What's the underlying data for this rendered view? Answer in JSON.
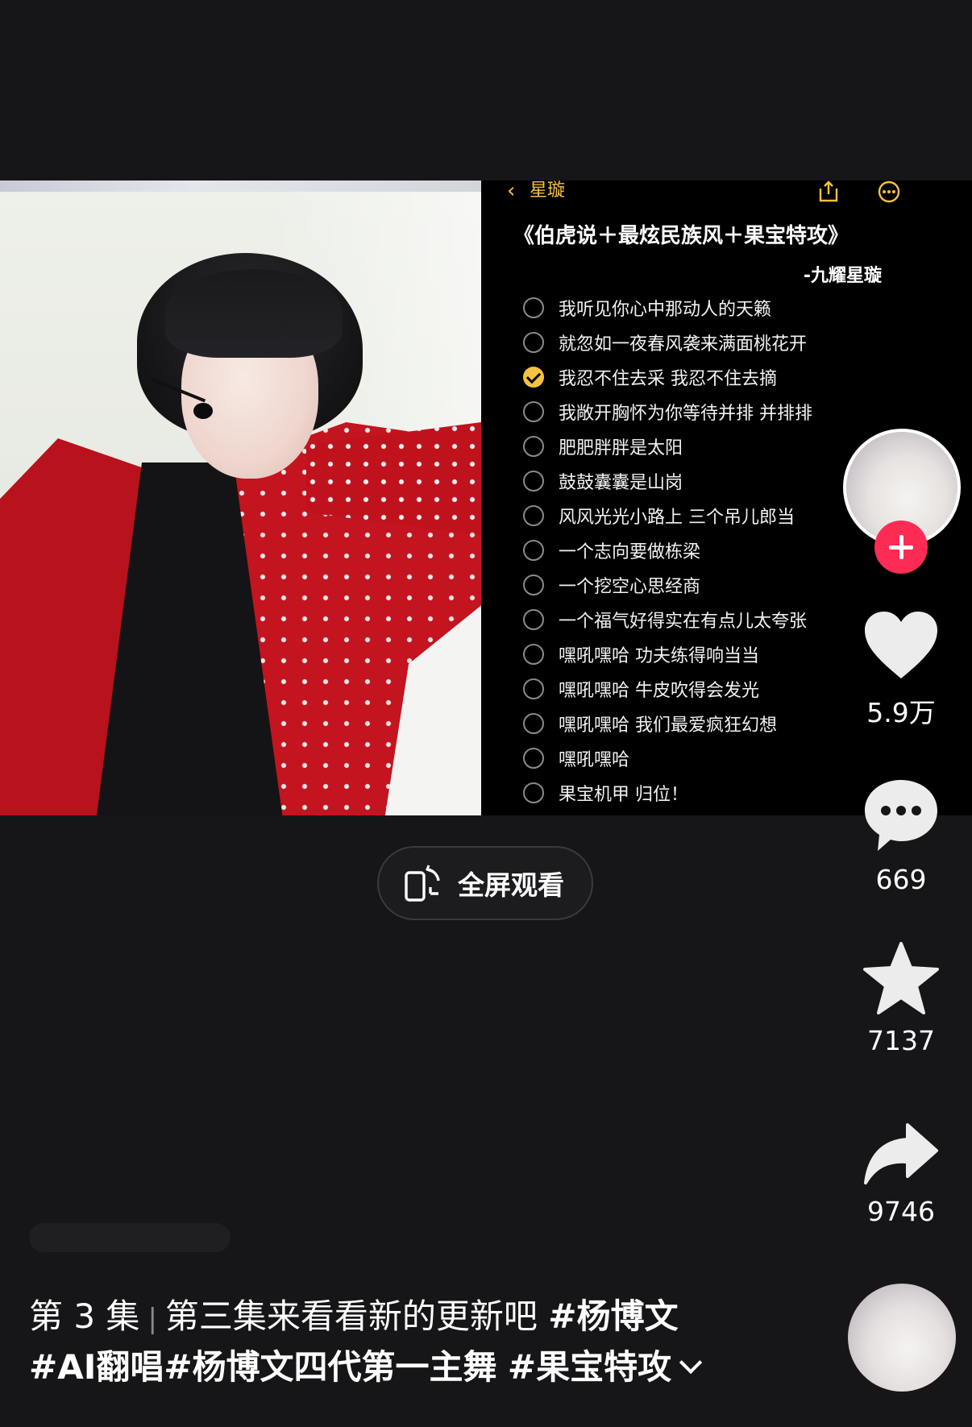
{
  "notes": {
    "back_label": "星璇",
    "title": "《伯虎说＋最炫民族风＋果宝特攻》",
    "author": "-九耀星璇",
    "items": [
      {
        "text": "我听见你心中那动人的天籁",
        "checked": false
      },
      {
        "text": "就忽如一夜春风袭来满面桃花开",
        "checked": false
      },
      {
        "text": "我忍不住去采 我忍不住去摘",
        "checked": true
      },
      {
        "text": "我敞开胸怀为你等待并排 并排排",
        "checked": false
      },
      {
        "text": "肥肥胖胖是太阳",
        "checked": false
      },
      {
        "text": "鼓鼓囊囊是山岗",
        "checked": false
      },
      {
        "text": "风风光光小路上 三个吊儿郎当",
        "checked": false
      },
      {
        "text": "一个志向要做栋梁",
        "checked": false
      },
      {
        "text": "一个挖空心思经商",
        "checked": false
      },
      {
        "text": "一个福气好得实在有点儿太夸张",
        "checked": false
      },
      {
        "text": "嘿吼嘿哈 功夫练得响当当",
        "checked": false
      },
      {
        "text": "嘿吼嘿哈 牛皮吹得会发光",
        "checked": false
      },
      {
        "text": "嘿吼嘿哈 我们最爱疯狂幻想",
        "checked": false
      },
      {
        "text": "嘿吼嘿哈",
        "checked": false
      },
      {
        "text": "果宝机甲 归位！",
        "checked": false
      }
    ]
  },
  "fullscreen": {
    "label": "全屏观看",
    "icon": "rotate-screen-icon"
  },
  "actions": {
    "like": {
      "count": "5.9万",
      "icon": "heart-icon"
    },
    "comment": {
      "count": "669",
      "icon": "comment-bubble-icon"
    },
    "favorite": {
      "count": "7137",
      "icon": "star-icon"
    },
    "share": {
      "count": "9746",
      "icon": "share-arrow-icon"
    }
  },
  "caption": {
    "episode": "第 3 集",
    "separator": "|",
    "text": "第三集来看看新的更新吧",
    "tag1": "#杨博文",
    "tag2": "#AI翻唱",
    "tag3": "#杨博文四代第一主舞",
    "tag4": "#果宝特攻"
  },
  "colors": {
    "background": "#161618",
    "accent_yellow": "#f6c242",
    "follow_red": "#fe2c55"
  }
}
